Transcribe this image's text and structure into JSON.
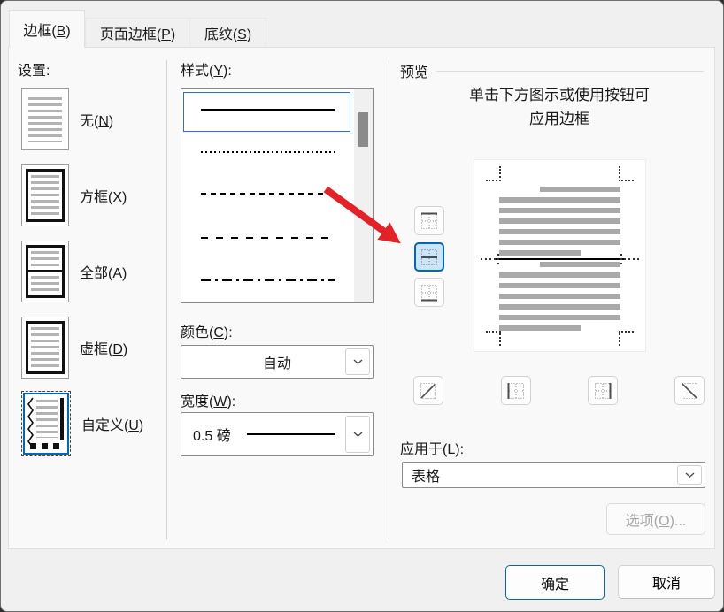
{
  "tabs": [
    {
      "prefix": "边框(",
      "key": "B",
      "suffix": ")",
      "active": true
    },
    {
      "prefix": "页面边框(",
      "key": "P",
      "suffix": ")",
      "active": false
    },
    {
      "prefix": "底纹(",
      "key": "S",
      "suffix": ")",
      "active": false
    }
  ],
  "settings": {
    "label": "设置:",
    "items": [
      {
        "name": "none",
        "prefix": "无(",
        "key": "N",
        "suffix": ")",
        "selected": false
      },
      {
        "name": "box",
        "prefix": "方框(",
        "key": "X",
        "suffix": ")",
        "selected": false
      },
      {
        "name": "all",
        "prefix": "全部(",
        "key": "A",
        "suffix": ")",
        "selected": false
      },
      {
        "name": "grid",
        "prefix": "虚框(",
        "key": "D",
        "suffix": ")",
        "selected": false
      },
      {
        "name": "custom",
        "prefix": "自定义(",
        "key": "U",
        "suffix": ")",
        "selected": true
      }
    ]
  },
  "style_section": {
    "label": {
      "prefix": "样式(",
      "key": "Y",
      "suffix": "):"
    },
    "line_styles": [
      "solid",
      "dotted",
      "dashed-small",
      "dashed-medium",
      "dash-dot"
    ],
    "selected_style": "solid",
    "color_label": {
      "prefix": "颜色(",
      "key": "C",
      "suffix": "):"
    },
    "color_value": "自动",
    "width_label": {
      "prefix": "宽度(",
      "key": "W",
      "suffix": "):"
    },
    "width_value": "0.5 磅"
  },
  "preview": {
    "group_label": "预览",
    "instruction_line1": "单击下方图示或使用按钮可",
    "instruction_line2": "应用边框",
    "buttons_left": [
      "top-border",
      "inside-horizontal-border",
      "bottom-border"
    ],
    "buttons_bottom": [
      "diagonal-up-border",
      "left-border",
      "right-border",
      "diagonal-down-border"
    ],
    "selected_button": "inside-horizontal-border",
    "apply_label": {
      "prefix": "应用于(",
      "key": "L",
      "suffix": "):"
    },
    "apply_value": "表格",
    "options_button": {
      "prefix": "选项(",
      "key": "O",
      "suffix": ")...",
      "disabled": true
    }
  },
  "footer": {
    "ok": "确定",
    "cancel": "取消"
  },
  "colors": {
    "accent": "#0067c0",
    "selection_fill": "#cce4f7",
    "arrow_red": "#e32126"
  }
}
